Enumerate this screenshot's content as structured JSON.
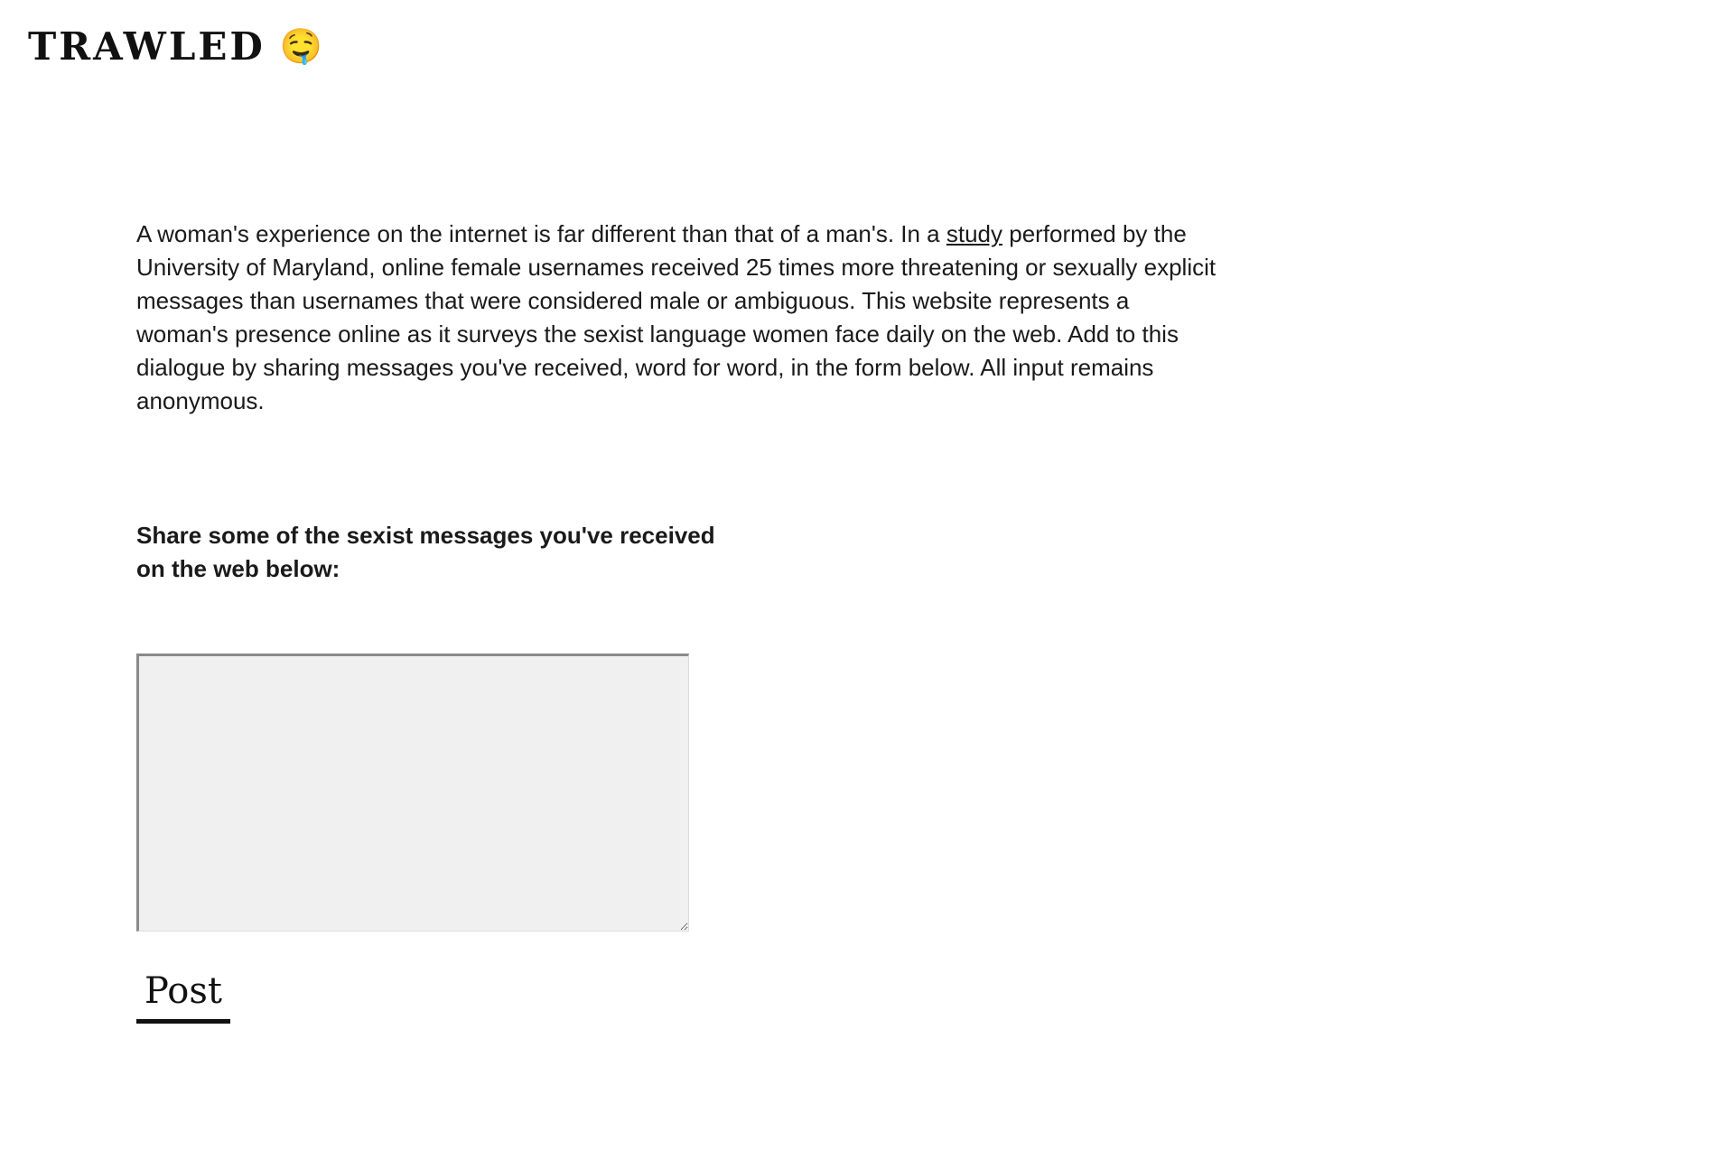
{
  "header": {
    "title": "TRAWLED",
    "icon_glyph": "🤤",
    "icon_name": "drooling-face-icon"
  },
  "intro": {
    "part1": "A woman's experience on the internet is far different than that of a man's. In a ",
    "link_label": "study",
    "part2": " performed by the University of Maryland, online female usernames received 25 times more threatening or sexually explicit messages than usernames that were considered male or ambiguous. This website represents a woman's presence online as it surveys the sexist language women face daily on the web. Add to this dialogue by sharing messages you've received, word for word, in the form below. All input remains anonymous."
  },
  "form": {
    "prompt": "Share some of the sexist messages you've received on the web below:",
    "message_value": "",
    "post_label": "Post"
  },
  "colors": {
    "background": "#ffffff",
    "text": "#111111",
    "textarea_bg": "#f0f0f0"
  }
}
